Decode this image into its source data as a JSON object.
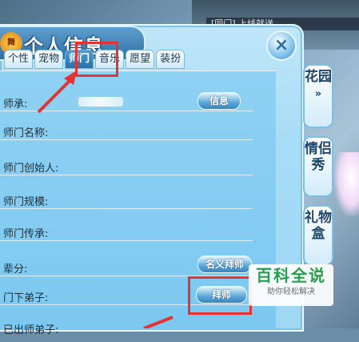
{
  "window": {
    "title": "个人信息",
    "logo_text": "舞",
    "top_banner": "[同门] 上线就送"
  },
  "tabs": [
    {
      "label": "个性",
      "active": false
    },
    {
      "label": "宠物",
      "active": false
    },
    {
      "label": "师门",
      "active": true
    },
    {
      "label": "音乐",
      "active": false
    },
    {
      "label": "愿望",
      "active": false
    },
    {
      "label": "装扮",
      "active": false
    }
  ],
  "fields": {
    "master": {
      "label": "师承:",
      "button": "信息"
    },
    "sect_name": {
      "label": "师门名称:"
    },
    "founder": {
      "label": "师门创始人:"
    },
    "scale": {
      "label": "师门规模:"
    },
    "legend": {
      "label": "师门传承:"
    },
    "seniority": {
      "label": "辈分:",
      "button": "名义拜师"
    },
    "disciples": {
      "label": "门下弟子:",
      "button": "拜师"
    },
    "graduated": {
      "label": "已出师弟子:"
    }
  },
  "side_tabs": [
    {
      "label": "花园",
      "sub": "»"
    },
    {
      "label": "情侣秀"
    },
    {
      "label": "礼物盒"
    }
  ],
  "close_icon": "×",
  "watermark": {
    "title": "百科全说",
    "subtitle": "助你轻松解决"
  },
  "colors": {
    "highlight": "#e53333",
    "accent": "#2b6fa6",
    "panel": "#a6dcf6"
  }
}
